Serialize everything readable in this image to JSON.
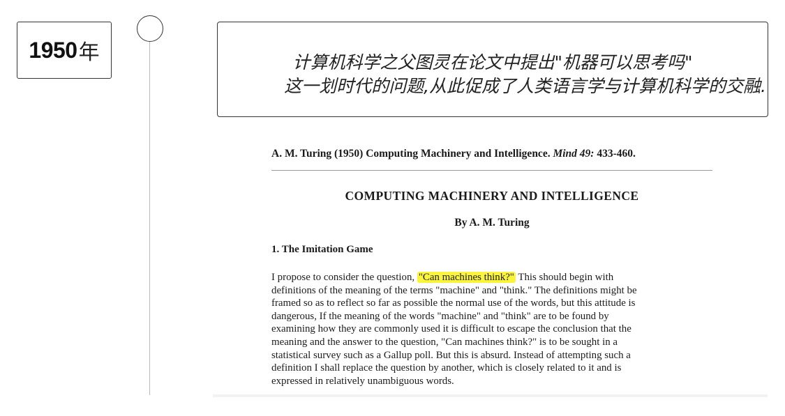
{
  "year": {
    "number": "1950",
    "suffix": "年"
  },
  "callout": {
    "line1": "计算机科学之父图灵在论文中提出\"机器可以思考吗\"",
    "line2": "这一划时代的问题,从此促成了人类语言学与计算机科学的交融."
  },
  "paper": {
    "citation_main": "A. M. Turing (1950) Computing Machinery and Intelligence. ",
    "citation_journal": "Mind 49:",
    "citation_pages": " 433-460.",
    "title": "COMPUTING MACHINERY AND INTELLIGENCE",
    "byline": "By A. M. Turing",
    "section_heading": "1. The Imitation Game",
    "line1_pre": "I propose to consider the question, ",
    "line1_highlight": "\"Can machines think?\"",
    "line1_post": " This should begin with",
    "lines": [
      "definitions of the meaning of the terms \"machine\" and \"think.\" The definitions might be",
      "framed so as to reflect so far as possible the normal use of the words, but this attitude is",
      "dangerous, If the meaning of the words \"machine\" and \"think\" are to be found by",
      "examining how they are commonly used it is difficult to escape the conclusion that the",
      "meaning and the answer to the question, \"Can machines think?\" is to be sought in a",
      "statistical survey such as a Gallup poll. But this is absurd. Instead of attempting such a",
      "definition I shall replace the question by another, which is closely related to it and is",
      "expressed in relatively unambiguous words."
    ]
  },
  "colors": {
    "highlight": "#fbf43d",
    "border": "#333333",
    "timeline": "#b9b9b9"
  }
}
